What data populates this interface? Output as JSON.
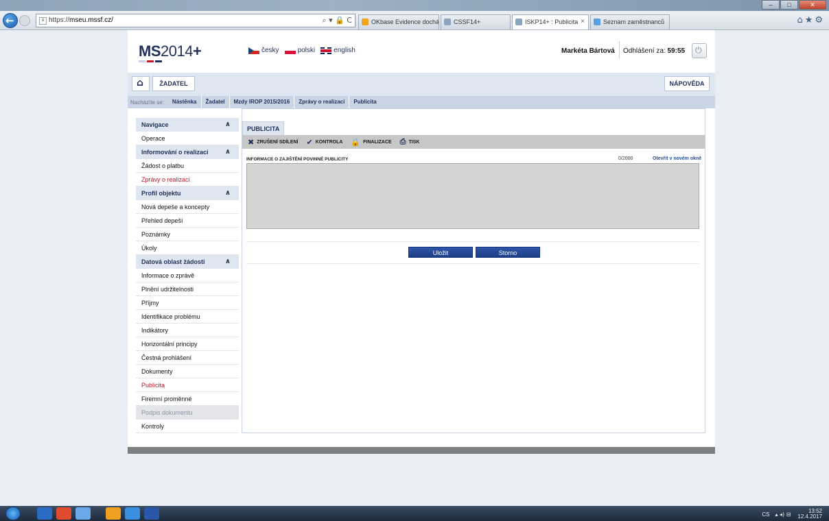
{
  "browser": {
    "url_prefix": "https://",
    "url_host": "mseu.mssf.cz/",
    "address_tools": "⌕ ▾ 🔒 C",
    "tabs": [
      {
        "label": "OKbase Evidence docházky",
        "icon_color": "#f2a51a"
      },
      {
        "label": "CSSF14+",
        "icon_color": "#8aa4c2"
      },
      {
        "label": "ISKP14+ : Publicita",
        "icon_color": "#8aa4c2",
        "active": true
      },
      {
        "label": "Seznam zaměstnanců",
        "icon_color": "#58a0e0"
      }
    ],
    "window_buttons": {
      "minimize": "–",
      "maximize": "□",
      "close": "✕"
    },
    "right_icons": "⌂★⚙"
  },
  "header": {
    "logo_bold": "MS",
    "logo_rest": "2014",
    "logo_plus": "+",
    "languages": [
      {
        "flag": "cz",
        "label": "česky"
      },
      {
        "flag": "pl",
        "label": "polski"
      },
      {
        "flag": "gb",
        "label": "english"
      }
    ],
    "user_name": "Markéta Bártová",
    "logout_label": "Odhlášení za: ",
    "logout_time": "59:55"
  },
  "toolbar": {
    "zadatel_label": "ŽADATEL",
    "help_label": "NÁPOVĚDA"
  },
  "breadcrumb": {
    "label": "Nacházíte se:",
    "items": [
      "Nástěnka",
      "Žadatel",
      "Mzdy IROP 2015/2016",
      "Zprávy o realizaci",
      "Publicita"
    ]
  },
  "sidebar": [
    {
      "label": "Navigace",
      "type": "section"
    },
    {
      "label": "Operace",
      "type": "item"
    },
    {
      "label": "Informování o realizaci",
      "type": "section"
    },
    {
      "label": "Žádost o platbu",
      "type": "item"
    },
    {
      "label": "Zprávy o realizaci",
      "type": "red"
    },
    {
      "label": "Profil objektu",
      "type": "section"
    },
    {
      "label": "Nová depeše a koncepty",
      "type": "item"
    },
    {
      "label": "Přehled depeší",
      "type": "item"
    },
    {
      "label": "Poznámky",
      "type": "item"
    },
    {
      "label": "Úkoly",
      "type": "item"
    },
    {
      "label": "Datová oblast žádosti",
      "type": "section"
    },
    {
      "label": "Informace o zprávě",
      "type": "item"
    },
    {
      "label": "Plnění udržitelnosti",
      "type": "item"
    },
    {
      "label": "Příjmy",
      "type": "item"
    },
    {
      "label": "Identifikace problému",
      "type": "item"
    },
    {
      "label": "Indikátory",
      "type": "item"
    },
    {
      "label": "Horizontální principy",
      "type": "item"
    },
    {
      "label": "Čestná prohlášení",
      "type": "item"
    },
    {
      "label": "Dokumenty",
      "type": "item"
    },
    {
      "label": "Publicita",
      "type": "red"
    },
    {
      "label": "Firemní proměnné",
      "type": "item"
    },
    {
      "label": "Podpis dokumentu",
      "type": "disabled"
    },
    {
      "label": "Kontroly",
      "type": "item"
    }
  ],
  "main": {
    "tab_label": "PUBLICITA",
    "actions": [
      {
        "icon": "✖",
        "label": "ZRUŠENÍ SDÍLENÍ"
      },
      {
        "icon": "✔",
        "label": "KONTROLA"
      },
      {
        "icon": "🔒",
        "label": "FINALIZACE"
      },
      {
        "icon": "⎙",
        "label": "TISK"
      }
    ],
    "field_label": "INFORMACE O ZAJIŠTĚNÍ POVINNÉ PUBLICITY",
    "field_counter": "0/2000",
    "field_link": "Otevřít v novém okně",
    "save_label": "Uložit",
    "cancel_label": "Storno"
  },
  "taskbar": {
    "apps": [
      {
        "name": "save-app-icon",
        "color": "#2b6cc4"
      },
      {
        "name": "chrome-app-icon",
        "color": "#e04a2f"
      },
      {
        "name": "notepad-app-icon",
        "color": "#6aa8e8"
      },
      {
        "name": "outlook-app-icon",
        "color": "#f0a020"
      },
      {
        "name": "ie-app-icon",
        "color": "#3a8fe0"
      },
      {
        "name": "word-app-icon",
        "color": "#2b57a8"
      }
    ],
    "lang": "CS",
    "time": "13:52",
    "date": "12.4.2017"
  },
  "colors": {
    "brand_navy": "#1f2f59",
    "accent_red": "#c4162a",
    "primary_button": "#1c3e86"
  }
}
